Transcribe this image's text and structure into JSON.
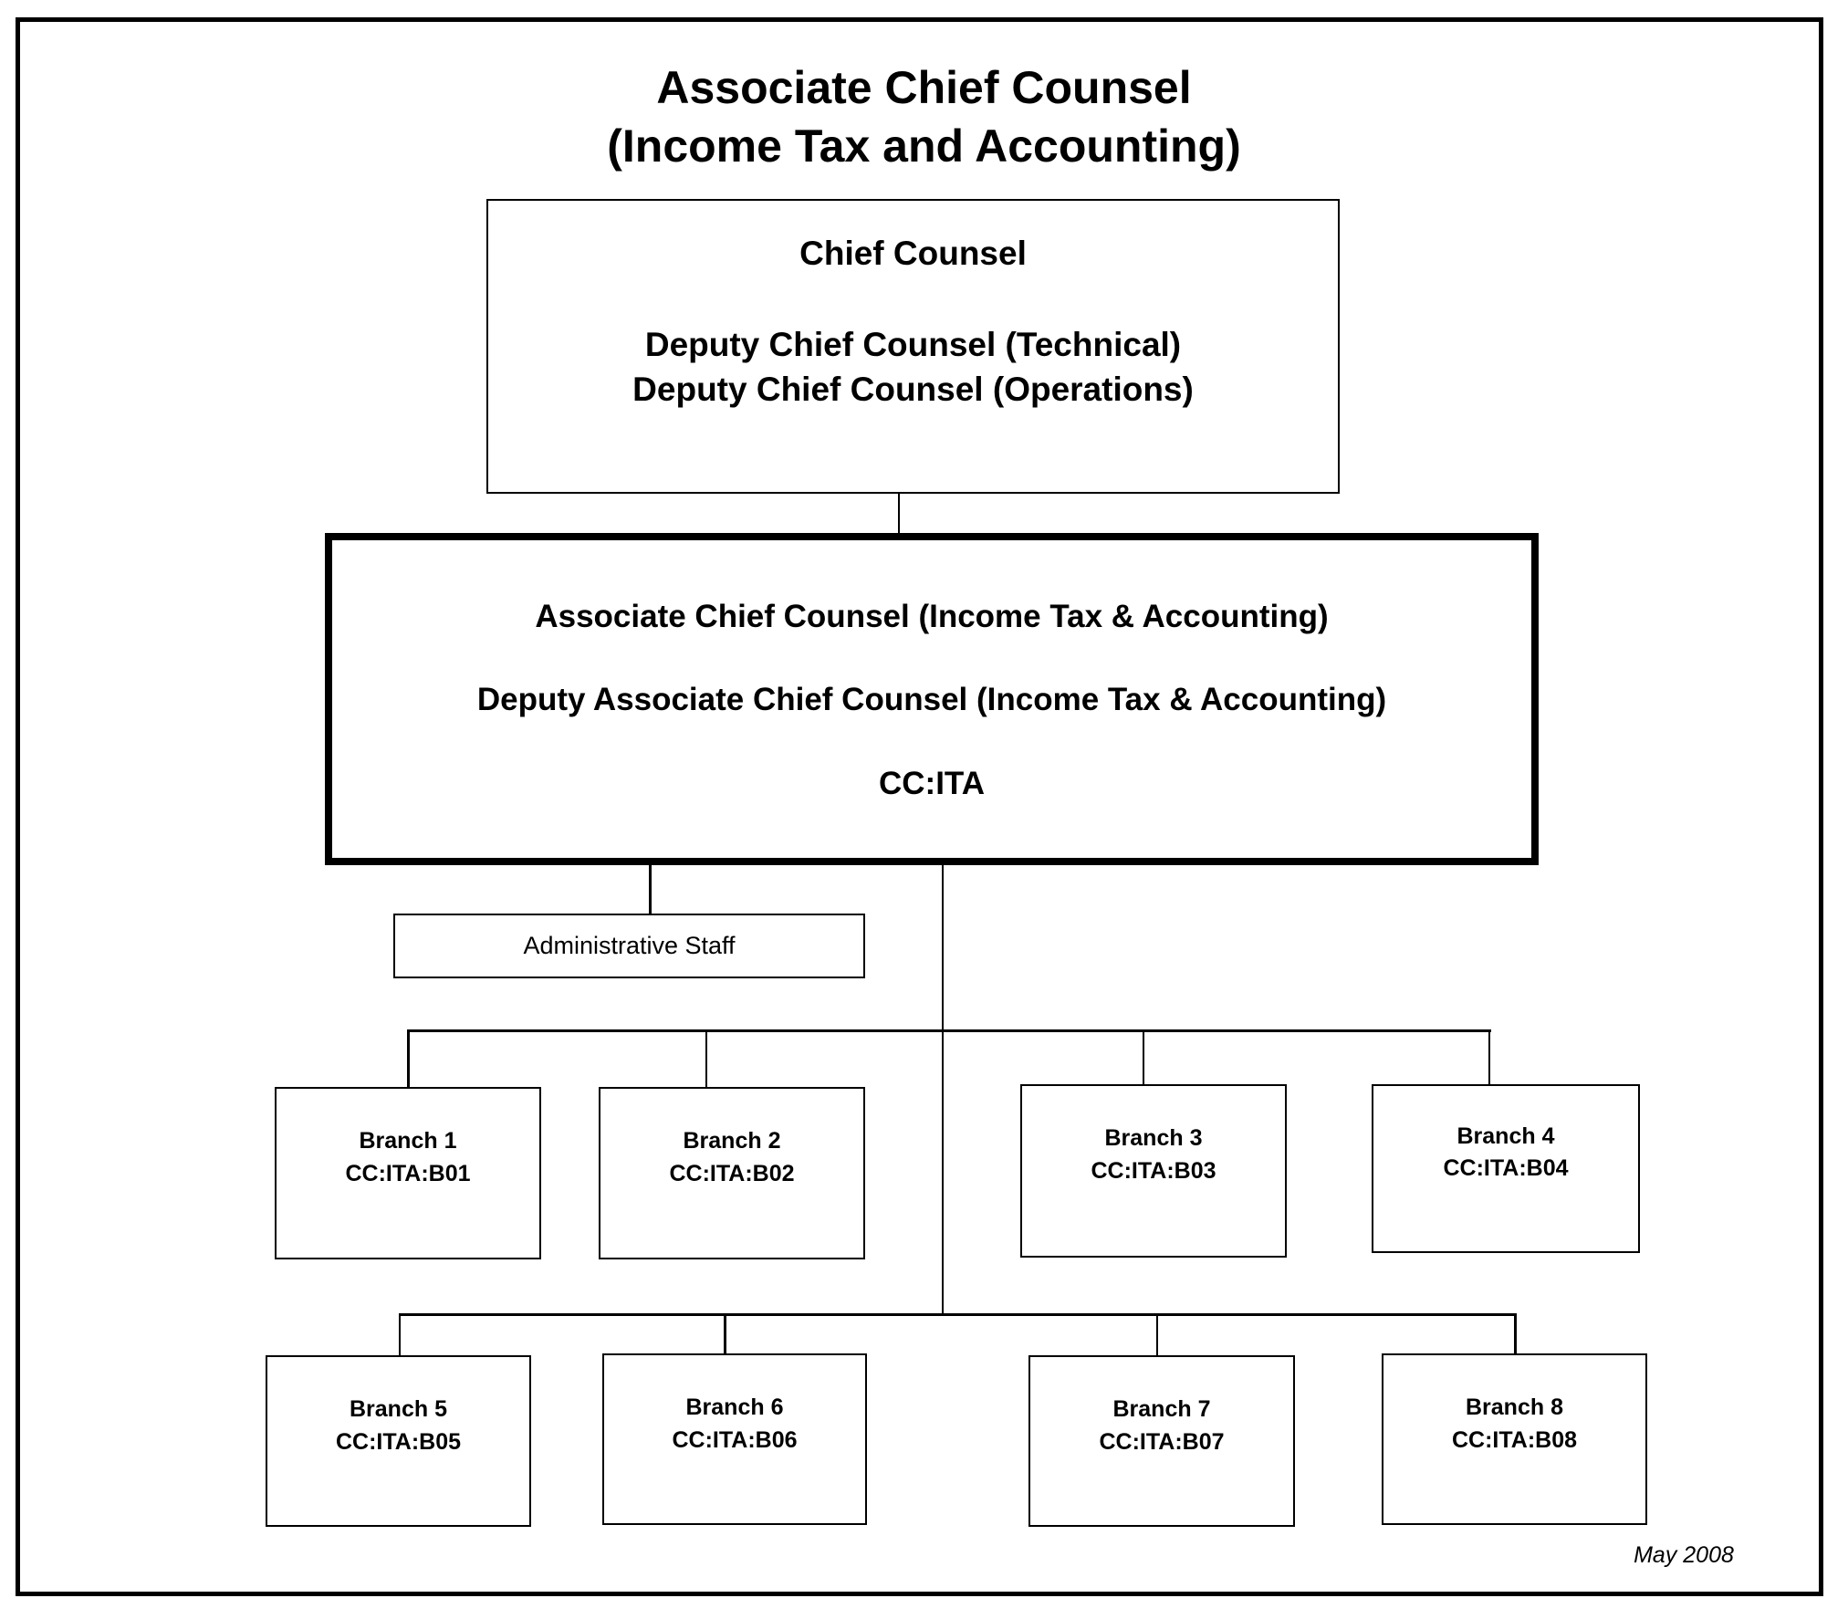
{
  "title": {
    "line1": "Associate Chief Counsel",
    "line2": "(Income Tax and Accounting)"
  },
  "chief_box": {
    "line1": "Chief Counsel",
    "line2": "Deputy Chief Counsel (Technical)",
    "line3": "Deputy Chief Counsel (Operations)"
  },
  "acc_box": {
    "line1": "Associate Chief Counsel (Income Tax & Accounting)",
    "line2": "Deputy Associate Chief Counsel (Income Tax & Accounting)",
    "line3": "CC:ITA"
  },
  "admin_box": {
    "label": "Administrative Staff"
  },
  "branches": [
    {
      "name": "Branch 1",
      "code": "CC:ITA:B01"
    },
    {
      "name": "Branch 2",
      "code": "CC:ITA:B02"
    },
    {
      "name": "Branch 3",
      "code": "CC:ITA:B03"
    },
    {
      "name": "Branch 4",
      "code": "CC:ITA:B04"
    },
    {
      "name": "Branch 5",
      "code": "CC:ITA:B05"
    },
    {
      "name": "Branch 6",
      "code": "CC:ITA:B06"
    },
    {
      "name": "Branch 7",
      "code": "CC:ITA:B07"
    },
    {
      "name": "Branch 8",
      "code": "CC:ITA:B08"
    }
  ],
  "footer": {
    "date": "May 2008"
  }
}
